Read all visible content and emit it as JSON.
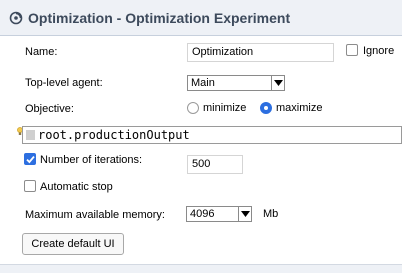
{
  "header": {
    "title": "Optimization - Optimization Experiment",
    "icon": "optimization-experiment-icon"
  },
  "form": {
    "name_label": "Name:",
    "name_value": "Optimization",
    "ignore_label": "Ignore",
    "ignore_checked": false,
    "top_level_agent_label": "Top-level agent:",
    "top_level_agent_value": "Main",
    "objective_label": "Objective:",
    "objective_options": [
      "minimize",
      "maximize"
    ],
    "objective_selected": "maximize",
    "objective_expression": "root.productionOutput",
    "iterations_label": "Number of iterations:",
    "iterations_checked": true,
    "iterations_value": "500",
    "automatic_stop_label": "Automatic stop",
    "automatic_stop_checked": false,
    "memory_label": "Maximum available memory:",
    "memory_value": "4096",
    "memory_unit": "Mb",
    "create_ui_button": "Create default UI"
  },
  "colors": {
    "accent": "#2d6fe0",
    "title_text": "#3d4a5c",
    "title_bg": "#eef1f6"
  }
}
